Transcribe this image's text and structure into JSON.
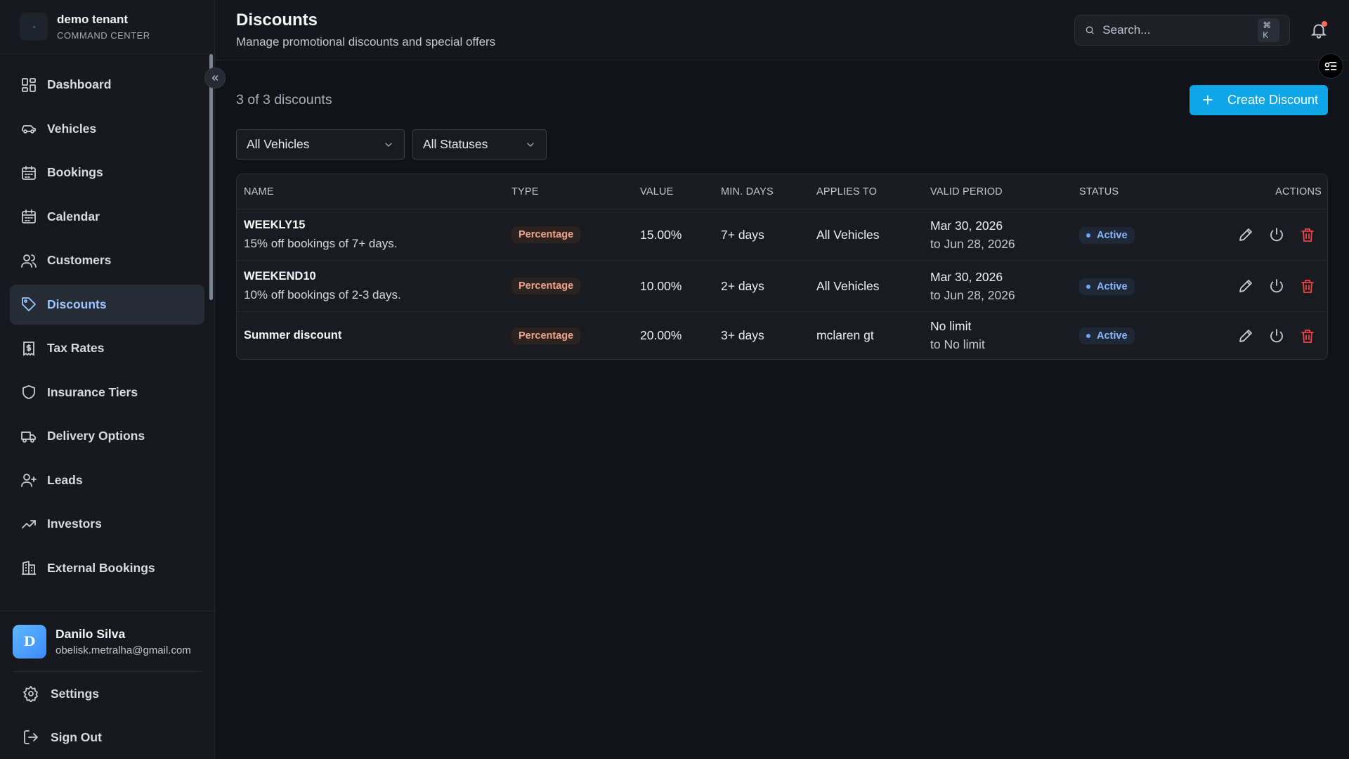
{
  "brand": {
    "name": "demo tenant",
    "subtitle": "COMMAND CENTER"
  },
  "nav": [
    {
      "label": "Dashboard",
      "icon": "dashboard-icon"
    },
    {
      "label": "Vehicles",
      "icon": "car-icon"
    },
    {
      "label": "Bookings",
      "icon": "calendar-icon"
    },
    {
      "label": "Calendar",
      "icon": "calendar-icon"
    },
    {
      "label": "Customers",
      "icon": "users-icon"
    },
    {
      "label": "Discounts",
      "icon": "tag-icon",
      "active": true
    },
    {
      "label": "Tax Rates",
      "icon": "receipt-icon"
    },
    {
      "label": "Insurance Tiers",
      "icon": "shield-icon"
    },
    {
      "label": "Delivery Options",
      "icon": "truck-icon"
    },
    {
      "label": "Leads",
      "icon": "user-plus-icon"
    },
    {
      "label": "Investors",
      "icon": "trending-up-icon"
    },
    {
      "label": "External Bookings",
      "icon": "building-icon"
    }
  ],
  "user": {
    "initial": "D",
    "name": "Danilo Silva",
    "email": "obelisk.metralha@gmail.com"
  },
  "footer": {
    "settings": "Settings",
    "signout": "Sign Out"
  },
  "header": {
    "title": "Discounts",
    "subtitle": "Manage promotional discounts and special offers",
    "search_placeholder": "Search...",
    "search_shortcut": "⌘ K"
  },
  "toolbar": {
    "count": "3 of 3 discounts",
    "create_label": "Create Discount"
  },
  "filters": {
    "vehicles": "All Vehicles",
    "statuses": "All Statuses"
  },
  "table": {
    "headers": [
      "NAME",
      "TYPE",
      "VALUE",
      "MIN. DAYS",
      "APPLIES TO",
      "VALID PERIOD",
      "STATUS",
      "ACTIONS"
    ],
    "rows": [
      {
        "name": "WEEKLY15",
        "desc": "15% off bookings of 7+ days.",
        "type": "Percentage",
        "value": "15.00%",
        "min_days": "7+ days",
        "applies_to": "All Vehicles",
        "period_from": "Mar 30, 2026",
        "period_to": "to Jun 28, 2026",
        "status": "Active"
      },
      {
        "name": "WEEKEND10",
        "desc": "10% off bookings of 2-3 days.",
        "type": "Percentage",
        "value": "10.00%",
        "min_days": "2+ days",
        "applies_to": "All Vehicles",
        "period_from": "Mar 30, 2026",
        "period_to": "to Jun 28, 2026",
        "status": "Active"
      },
      {
        "name": "Summer discount",
        "desc": "",
        "type": "Percentage",
        "value": "20.00%",
        "min_days": "3+ days",
        "applies_to": "mclaren gt",
        "period_from": "No limit",
        "period_to": "to No limit",
        "status": "Active"
      }
    ]
  },
  "colors": {
    "accent": "#0ea5e9",
    "active_nav": "#9cc6ff",
    "delete": "#ef4444",
    "background": "#111318"
  }
}
